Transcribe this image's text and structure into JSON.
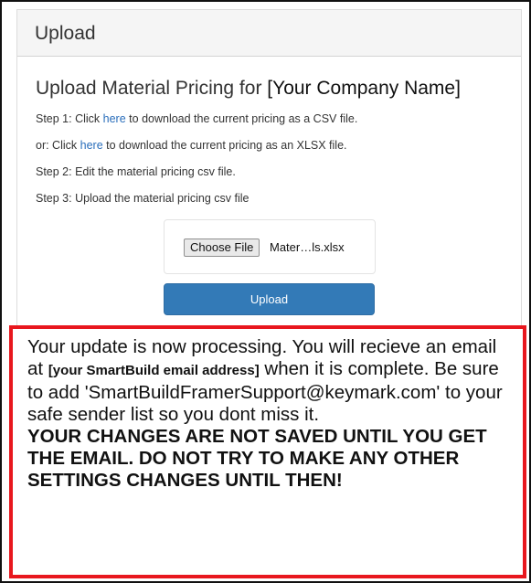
{
  "panel": {
    "header_title": "Upload"
  },
  "content": {
    "heading_prefix": "Upload Material Pricing for",
    "company_placeholder": "[Your Company Name]",
    "step1_prefix": "Step 1: Click",
    "step1_link": "here",
    "step1_suffix": "to download the current pricing as a CSV file.",
    "step1b_prefix": "or: Click",
    "step1b_link": "here",
    "step1b_suffix": "to download the current pricing as an XLSX file.",
    "step2": "Step 2: Edit the material pricing csv file.",
    "step3": "Step 3: Upload the material pricing csv file"
  },
  "file_input": {
    "button_label": "Choose File",
    "file_name": "Mater…ls.xlsx"
  },
  "upload_button": {
    "label": "Upload"
  },
  "notice": {
    "line_a": "Your update is now processing. You will recieve an email at",
    "email_placeholder": "[your SmartBuild email address]",
    "line_b": "when it is complete. Be sure to add 'SmartBuildFramerSupport@keymark.com' to your safe sender list so you dont miss it.",
    "warning": "YOUR CHANGES ARE NOT SAVED UNTIL YOU GET THE EMAIL. DO NOT TRY TO MAKE ANY OTHER SETTINGS CHANGES UNTIL THEN!"
  },
  "colors": {
    "link": "#2a6ebb",
    "primary_button": "#337ab7",
    "notice_border": "#e8171e"
  }
}
